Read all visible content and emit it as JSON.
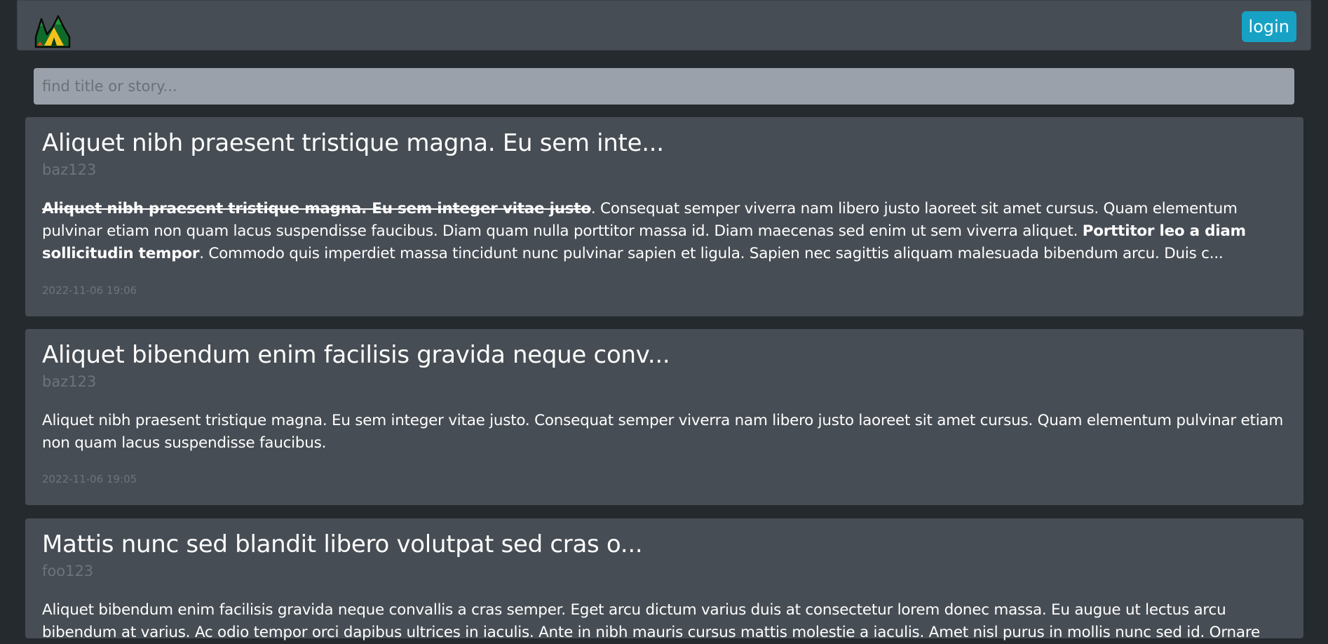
{
  "navbar": {
    "login_label": "login"
  },
  "search": {
    "placeholder": "find title or story..."
  },
  "posts": [
    {
      "title": "Aliquet nibh praesent tristique magna. Eu sem inte...",
      "author": "baz123",
      "body_strike": "Aliquet nibh praesent tristique magna. Eu sem integer vitae justo",
      "body_part1": ". Consequat semper viverra nam libero justo laoreet sit amet cursus. Quam elementum pulvinar etiam non quam lacus suspendisse faucibus. Diam quam nulla porttitor massa id. Diam maecenas sed enim ut sem viverra aliquet. ",
      "body_bold": "Porttitor leo a diam sollicitudin tempor",
      "body_part2": ". Commodo quis imperdiet massa tincidunt nunc pulvinar sapien et ligula. Sapien nec sagittis aliquam malesuada bibendum arcu. Duis c...",
      "date": "2022-11-06 19:06"
    },
    {
      "title": "Aliquet bibendum enim facilisis gravida neque conv...",
      "author": "baz123",
      "body": "Aliquet nibh praesent tristique magna. Eu sem integer vitae justo. Consequat semper viverra nam libero justo laoreet sit amet cursus. Quam elementum pulvinar etiam non quam lacus suspendisse faucibus.",
      "date": "2022-11-06 19:05"
    },
    {
      "title": "Mattis nunc sed blandit libero volutpat sed cras o...",
      "author": "foo123",
      "body": "Aliquet bibendum enim facilisis gravida neque convallis a cras semper. Eget arcu dictum varius duis at consectetur lorem donec massa. Eu augue ut lectus arcu bibendum at varius. Ac odio tempor orci dapibus ultrices in iaculis. Ante in nibh mauris cursus mattis molestie a iaculis. Amet nisl purus in mollis nunc sed id. Ornare"
    }
  ]
}
